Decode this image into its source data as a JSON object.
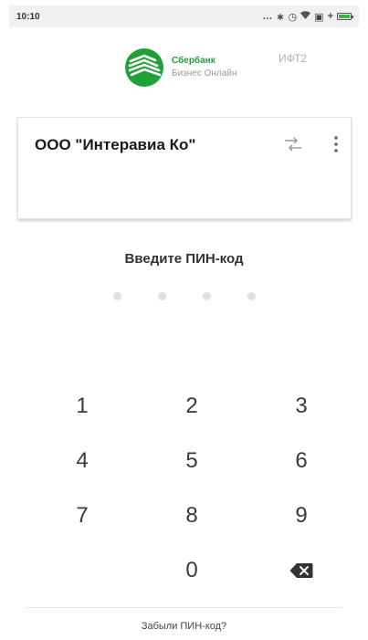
{
  "status_bar": {
    "time": "10:10",
    "icons": [
      "dots-icon",
      "bluetooth-icon",
      "alarm-icon",
      "wifi-icon",
      "sim-icon",
      "charging-icon",
      "battery-icon"
    ]
  },
  "header": {
    "brand_name": "Сбербанк",
    "brand_subtitle": "Бизнес Онлайн",
    "environment": "ИФТ2",
    "brand_color": "#21a038"
  },
  "org_card": {
    "name": "ООО \"Интеравиа Ко\""
  },
  "pin": {
    "title": "Введите ПИН-код",
    "entered_digits": 0,
    "total_digits": 4
  },
  "keypad": {
    "keys": [
      "1",
      "2",
      "3",
      "4",
      "5",
      "6",
      "7",
      "8",
      "9",
      "",
      "0",
      "backspace"
    ]
  },
  "footer": {
    "forgot_label": "Забыли ПИН-код?"
  }
}
